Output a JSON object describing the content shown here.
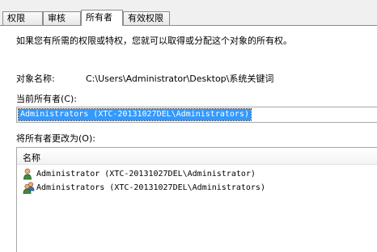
{
  "tabs": [
    {
      "label": "权限",
      "active": false
    },
    {
      "label": "审核",
      "active": false
    },
    {
      "label": "所有者",
      "active": true
    },
    {
      "label": "有效权限",
      "active": false
    }
  ],
  "description": "如果您有所需的权限或特权，您就可以取得或分配这个对象的所有权。",
  "object": {
    "label": "对象名称:",
    "value": "C:\\Users\\Administrator\\Desktop\\系统关键词"
  },
  "current_owner": {
    "label": "当前所有者(C):",
    "value": "Administrators (XTC-20131027DEL\\Administrators)"
  },
  "change_owner": {
    "label": "将所有者更改为(O):",
    "column_header": "名称",
    "items": [
      {
        "name": "Administrator (XTC-20131027DEL\\Administrator)",
        "icon": "user-icon"
      },
      {
        "name": "Administrators (XTC-20131027DEL\\Administrators)",
        "icon": "group-icon"
      }
    ]
  }
}
